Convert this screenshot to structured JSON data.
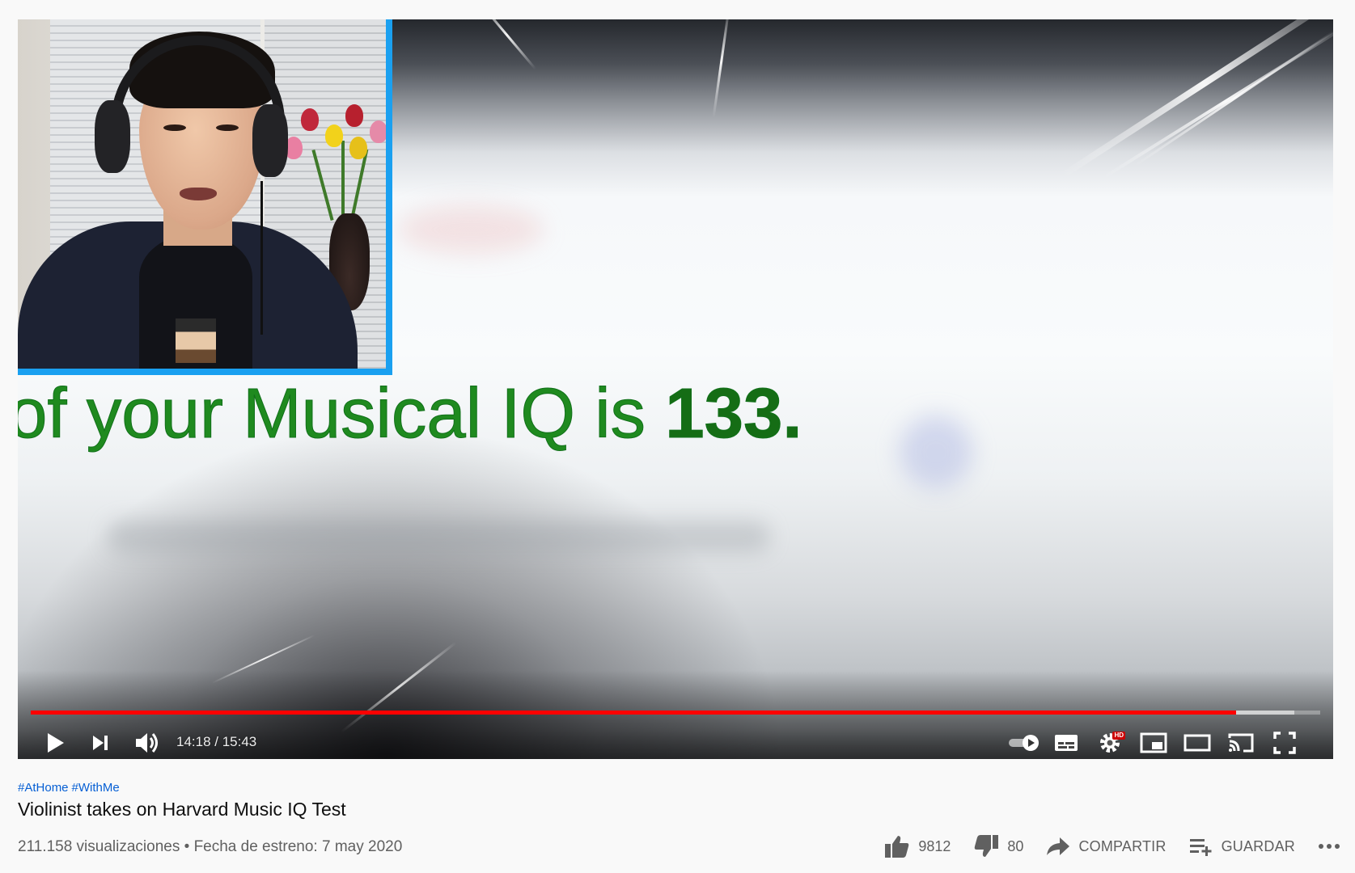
{
  "player": {
    "overlay_text_regular": "of your Musical IQ is ",
    "overlay_text_bold": "133.",
    "time_current": "14:18",
    "time_separator": " / ",
    "time_total": "15:43",
    "progress_played": 0.935,
    "progress_buffered": 0.98,
    "hd_badge": "HD",
    "accent_color": "#ff0000",
    "webcam_border_color": "#1aa0f0"
  },
  "video": {
    "hashtags": [
      "#AtHome",
      "#WithMe"
    ],
    "title": "Violinist takes on Harvard Music IQ Test",
    "views": "211.158 visualizaciones",
    "dot": " • ",
    "premiere": "Fecha de estreno: 7 may 2020"
  },
  "actions": {
    "likes": "9812",
    "dislikes": "80",
    "share_label": "COMPARTIR",
    "save_label": "GUARDAR"
  },
  "icons": {
    "play": "play-icon",
    "next": "next-icon",
    "volume": "volume-icon",
    "autoplay": "autoplay-toggle-icon",
    "subtitles": "subtitles-icon",
    "settings": "settings-gear-icon",
    "miniplayer": "miniplayer-icon",
    "theater": "theater-mode-icon",
    "cast": "cast-icon",
    "fullscreen": "fullscreen-icon",
    "like": "thumbs-up-icon",
    "dislike": "thumbs-down-icon",
    "share": "share-arrow-icon",
    "save": "add-to-playlist-icon",
    "more": "more-horizontal-icon"
  }
}
